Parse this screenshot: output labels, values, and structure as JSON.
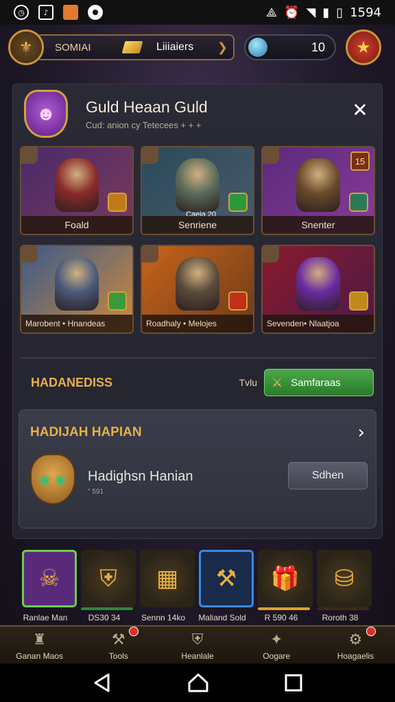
{
  "status_bar": {
    "time": "1594",
    "left_icons": [
      "clock-icon",
      "music-icon",
      "app-icon",
      "circle-icon"
    ],
    "right_icons": [
      "vibrate-icon",
      "alarm-icon",
      "wifi-icon",
      "signal-icon",
      "battery-icon"
    ]
  },
  "resources": {
    "label": "SOMIAI",
    "gold_label": "Liiiaiers",
    "gem_value": "10"
  },
  "guild": {
    "title": "Guld Heaan Guld",
    "subtitle": "Cud: anion cy Tetecees + + +",
    "close_label": "✕"
  },
  "heroes": [
    {
      "name": "Foald",
      "sub": "",
      "num": "",
      "colors": [
        "#4a2a6a",
        "#7a3a5a"
      ],
      "figure": "#8a2a2a",
      "badge": "#c07a1a"
    },
    {
      "name": "Senriene",
      "sub": "Caeia 20",
      "num": "",
      "colors": [
        "#2a4a5a",
        "#4a5a6a"
      ],
      "figure": "#5a6a5a",
      "badge": "#2a9a3a"
    },
    {
      "name": "Snenter",
      "sub": "",
      "num": "15",
      "colors": [
        "#5a2a7a",
        "#8a3a9a"
      ],
      "figure": "#6a4a2a",
      "badge": "#2a7a5a"
    },
    {
      "name": "Marobent • Hnandeas",
      "sub": "",
      "num": "",
      "colors": [
        "#3a5a8a",
        "#d08a3a"
      ],
      "figure": "#4a5a7a",
      "badge": "#3a9a3a"
    },
    {
      "name": "Roadhaly • Melojes",
      "sub": "",
      "num": "",
      "colors": [
        "#c8641a",
        "#6a3a1a"
      ],
      "figure": "#5a4a3a",
      "badge": "#c0301a"
    },
    {
      "name": "Sevenden• Nlaatjoa",
      "sub": "",
      "num": "",
      "colors": [
        "#8a1a2a",
        "#4a1a4a"
      ],
      "figure": "#6a2aa0",
      "badge": "#c08a1a"
    }
  ],
  "section": {
    "title": "HADANEDISS",
    "small_label": "Tvlu",
    "button_label": "Samfaraas"
  },
  "featured": {
    "title": "HADIJAH HAPIAN",
    "name": "Hadighsn Hanian",
    "meta": "\" 591",
    "button_label": "Sdhen"
  },
  "items": [
    {
      "label": "Ranlae Man",
      "icon": "demon-mask-icon",
      "bg": "#5a2a7a",
      "border": "#6ad04a",
      "bar": ""
    },
    {
      "label": "DS30 34",
      "icon": "crest-icon",
      "bg": "#2a2418",
      "border": "",
      "bar": "#2a8a3a"
    },
    {
      "label": "Sennn 14ko",
      "icon": "cash-bundle-icon",
      "bg": "#2a2418",
      "border": "",
      "bar": ""
    },
    {
      "label": "Maliand Sold",
      "icon": "weapon-icon",
      "bg": "#1a2a4a",
      "border": "#3a8ae0",
      "bar": ""
    },
    {
      "label": "R 590 46",
      "icon": "gift-box-icon",
      "bg": "#2a2418",
      "border": "",
      "bar": "#e0a02a"
    },
    {
      "label": "Roroth 38",
      "icon": "treasure-icon",
      "bg": "#2a2418",
      "border": "",
      "bar": "#3a2a1a"
    }
  ],
  "nav": [
    {
      "label": "Ganan Maos",
      "icon": "castle-icon",
      "dot": false
    },
    {
      "label": "Tools",
      "icon": "hammer-icon",
      "dot": true
    },
    {
      "label": "Heanlale",
      "icon": "shield-icon",
      "dot": false
    },
    {
      "label": "Oogare",
      "icon": "star-wand-icon",
      "dot": false
    },
    {
      "label": "Hoagaelis",
      "icon": "tools-icon",
      "dot": true
    }
  ]
}
